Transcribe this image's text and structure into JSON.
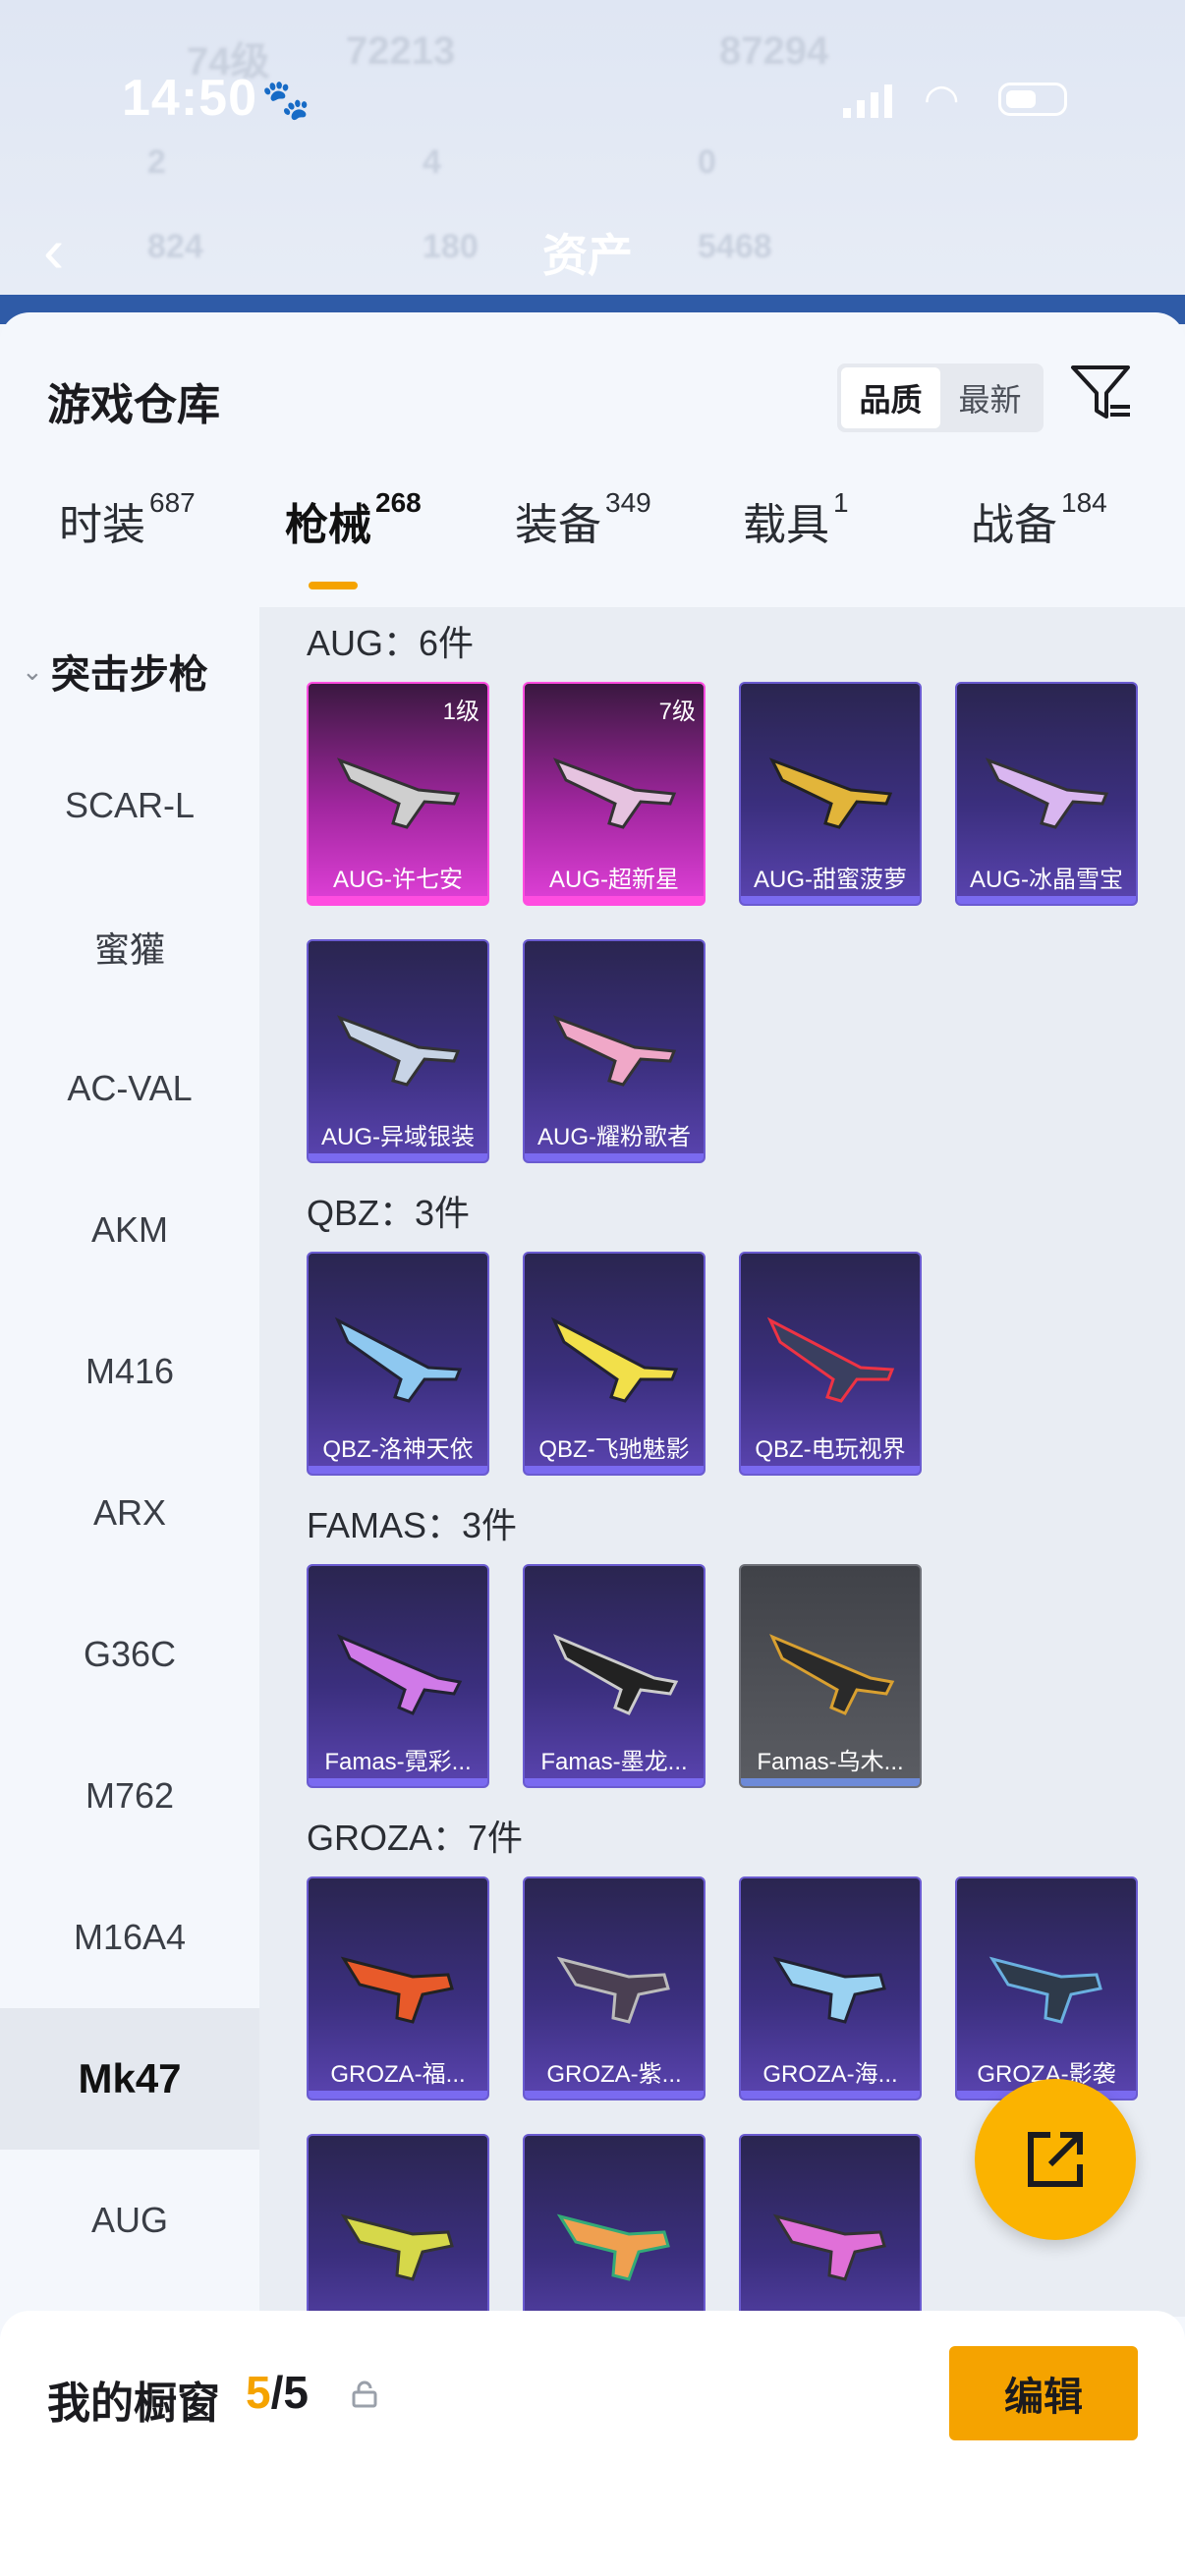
{
  "status_bar": {
    "time": "14:50"
  },
  "background": {
    "back_icon": "chevron-left-icon",
    "title": "资产",
    "ghost_1": "74级",
    "ghost_2": "72213",
    "ghost_3": "87294",
    "ghost_4": "2",
    "ghost_5": "4",
    "ghost_6": "0",
    "ghost_7": "824",
    "ghost_8": "180",
    "ghost_9": "5468"
  },
  "sheet": {
    "title": "游戏仓库",
    "sort": {
      "options": [
        "品质",
        "最新"
      ],
      "selected": "品质"
    },
    "filter_icon": "filter-icon"
  },
  "tabs": [
    {
      "label": "时装",
      "count": "687"
    },
    {
      "label": "枪械",
      "count": "268"
    },
    {
      "label": "装备",
      "count": "349"
    },
    {
      "label": "载具",
      "count": "1"
    },
    {
      "label": "战备",
      "count": "184"
    }
  ],
  "active_tab": "枪械",
  "sidebar": {
    "category": "突击步枪",
    "items": [
      "SCAR-L",
      "蜜獾",
      "AC-VAL",
      "AKM",
      "M416",
      "ARX",
      "G36C",
      "M762",
      "M16A4",
      "Mk47",
      "AUG"
    ],
    "active": "Mk47"
  },
  "sections": [
    {
      "header": "AUG：6件",
      "items": [
        {
          "name": "AUG-许七安",
          "level": "1级",
          "rarity": "pink"
        },
        {
          "name": "AUG-超新星",
          "level": "7级",
          "rarity": "pink"
        },
        {
          "name": "AUG-甜蜜菠萝",
          "rarity": "purple"
        },
        {
          "name": "AUG-冰晶雪宝",
          "rarity": "purple"
        },
        {
          "name": "AUG-异域银装",
          "rarity": "purple"
        },
        {
          "name": "AUG-耀粉歌者",
          "rarity": "purple"
        }
      ]
    },
    {
      "header": "QBZ：3件",
      "items": [
        {
          "name": "QBZ-洛神天依",
          "rarity": "purple"
        },
        {
          "name": "QBZ-飞驰魅影",
          "rarity": "purple"
        },
        {
          "name": "QBZ-电玩视界",
          "rarity": "purple"
        }
      ]
    },
    {
      "header": "FAMAS：3件",
      "items": [
        {
          "name": "Famas-霓彩...",
          "rarity": "purple"
        },
        {
          "name": "Famas-墨龙...",
          "rarity": "purple"
        },
        {
          "name": "Famas-乌木...",
          "rarity": "gray"
        }
      ]
    },
    {
      "header": "GROZA：7件",
      "items": [
        {
          "name": "GROZA-福...",
          "rarity": "purple"
        },
        {
          "name": "GROZA-紫...",
          "rarity": "purple"
        },
        {
          "name": "GROZA-海...",
          "rarity": "purple"
        },
        {
          "name": "GROZA-影袭",
          "rarity": "purple"
        },
        {
          "name": "",
          "rarity": "purple"
        },
        {
          "name": "",
          "rarity": "purple"
        },
        {
          "name": "",
          "rarity": "purple"
        }
      ]
    }
  ],
  "share_icon": "share-external-icon",
  "showcase": {
    "title": "我的橱窗",
    "current": "5",
    "separator": "/",
    "total": "5",
    "lock_icon": "lock-icon",
    "edit_label": "编辑"
  },
  "colors": {
    "accent": "#f5a300",
    "pink_rarity": "#e040d8",
    "purple_rarity": "#5a44b0",
    "gray_rarity": "#5b5d63"
  }
}
